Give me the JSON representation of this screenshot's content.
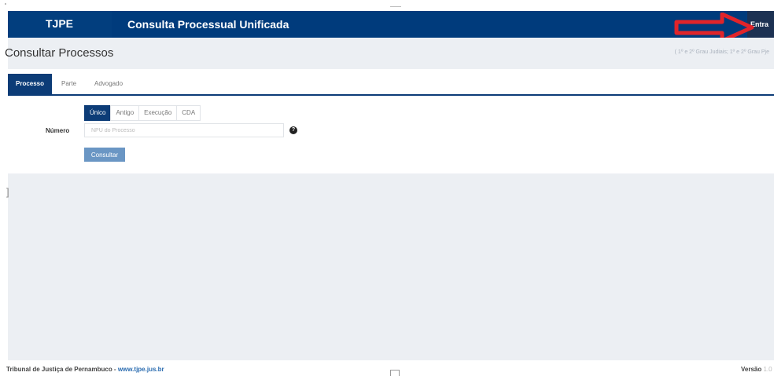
{
  "header": {
    "brand": "TJPE",
    "app_title": "Consulta Processual Unificada",
    "login_label": "Entra"
  },
  "subheader": {
    "page_title": "Consultar Processos",
    "instances_note": "( 1º e 2º Grau Judiais; 1º e 2º Grau Pje"
  },
  "tabs": [
    "Processo",
    "Parte",
    "Advogado"
  ],
  "form": {
    "number_label": "Número",
    "type_options": [
      "Único",
      "Antigo",
      "Execução",
      "CDA"
    ],
    "selected_type": "Único",
    "npu_placeholder": "NPU do Processo",
    "submit_label": "Consultar"
  },
  "footer": {
    "org": "Tribunal de Justiça de Pernambuco - ",
    "site": "www.tjpe.jus.br",
    "version_label": "Versão",
    "version_value": "1.0"
  },
  "colors": {
    "header_bg": "#003b7c",
    "accent": "#0c3c77",
    "button": "#6a96c4",
    "annotation_arrow": "#e0242a"
  }
}
